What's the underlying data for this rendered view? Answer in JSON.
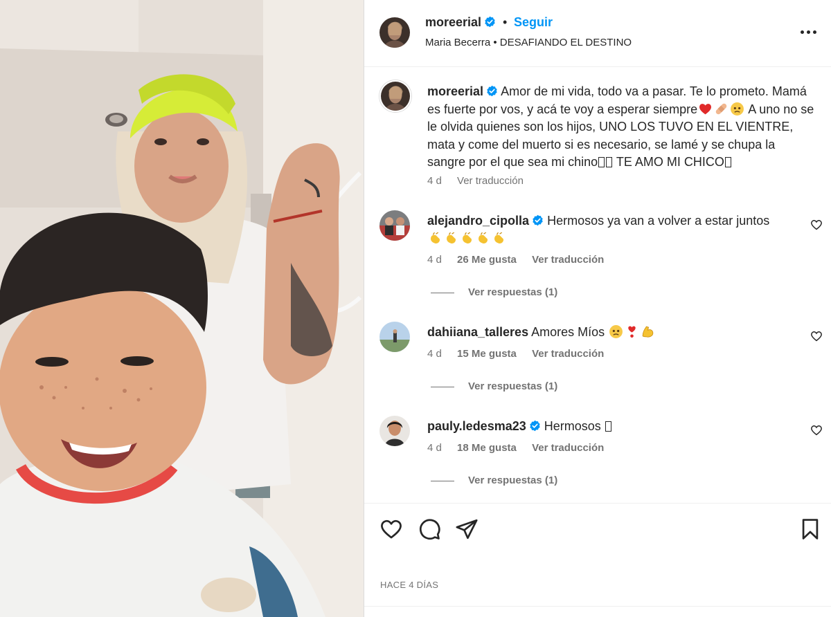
{
  "post": {
    "username": "moreerial",
    "separator": "•",
    "follow_label": "Seguir",
    "subtitle": "Maria Becerra • DESAFIANDO EL DESTINO"
  },
  "caption": {
    "username": "moreerial",
    "text_1": "Amor de mi vida, todo va a pasar. Te lo prometo. Mamá es fuerte por vos, y acá te voy a esperar siempre",
    "text_2": "A uno no se le olvida quienes son los hijos, UNO LOS TUVO EN EL VIENTRE, mata y come del muerto si es necesario, se lamé y se chupa la sangre por el que sea mi chino",
    "text_3": " TE AMO MI CHICO",
    "age": "4 d",
    "translate": "Ver traducción"
  },
  "comments": [
    {
      "username": "alejandro_cipolla",
      "verified": true,
      "text": "Hermosos ya van a volver a estar juntos",
      "age": "4 d",
      "likes": "26 Me gusta",
      "translate": "Ver traducción",
      "replies": "Ver respuestas (1)"
    },
    {
      "username": "dahiiana_talleres",
      "verified": false,
      "text": "Amores Míos",
      "age": "4 d",
      "likes": "15 Me gusta",
      "translate": "Ver traducción",
      "replies": "Ver respuestas (1)"
    },
    {
      "username": "pauly.ledesma23",
      "verified": true,
      "text": "Hermosos",
      "age": "4 d",
      "likes": "18 Me gusta",
      "translate": "Ver traducción",
      "replies": "Ver respuestas (1)"
    }
  ],
  "footer": {
    "timestamp": "HACE 4 DÍAS"
  },
  "icons": {
    "like": "heart-icon",
    "comment": "comment-icon",
    "share": "paper-plane-icon",
    "save": "bookmark-icon",
    "more": "more-options-icon"
  },
  "colors": {
    "accent": "#0095f6",
    "text": "#262626",
    "muted": "#737373",
    "verified": "#0095f6"
  }
}
